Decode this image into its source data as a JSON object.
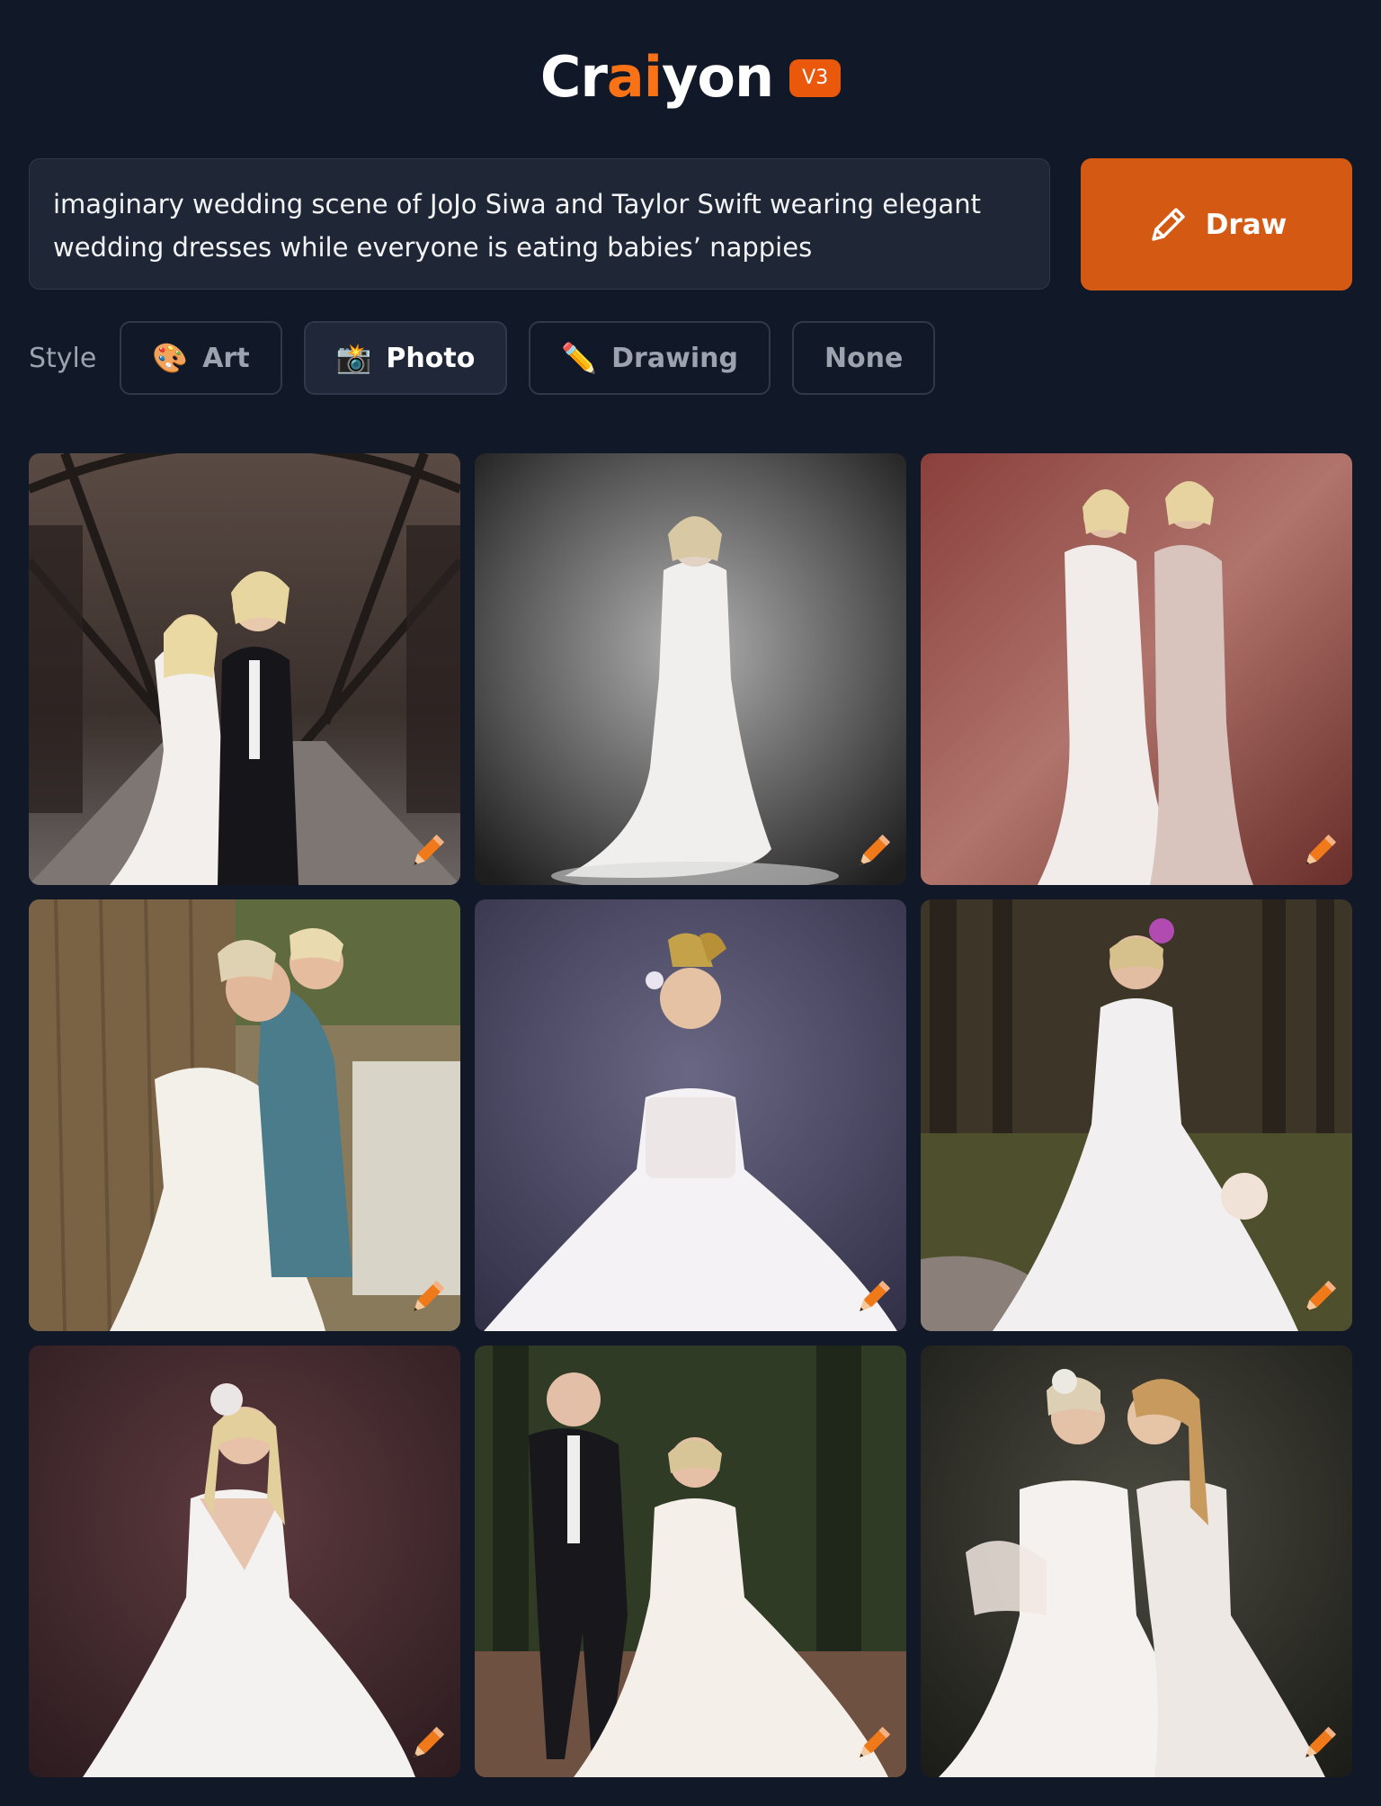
{
  "header": {
    "logo_parts": [
      "Cr",
      "ai",
      "yon"
    ],
    "version_badge": "V3",
    "accent_color": "#f97316"
  },
  "prompt": {
    "value": "imaginary wedding scene of JoJo Siwa and Taylor Swift wearing elegant\nwedding dresses while everyone is eating babies’ nappies"
  },
  "draw_button": {
    "label": "Draw",
    "icon": "pencil-icon",
    "color": "#d45a13"
  },
  "style": {
    "label": "Style",
    "options": [
      {
        "label": "Art",
        "icon": "palette-emoji",
        "glyph": "🎨",
        "selected": false
      },
      {
        "label": "Photo",
        "icon": "camera-flash-emoji",
        "glyph": "📸",
        "selected": true
      },
      {
        "label": "Drawing",
        "icon": "pencil-emoji",
        "glyph": "✏️",
        "selected": false
      },
      {
        "label": "None",
        "icon": "",
        "glyph": "",
        "selected": false
      }
    ]
  },
  "images": [
    {
      "scene": "cathedral-corridor-couple",
      "icon": "edit-pencil-icon"
    },
    {
      "scene": "gray-studio-single-bride",
      "icon": "edit-pencil-icon"
    },
    {
      "scene": "rose-background-two-brides",
      "icon": "edit-pencil-icon"
    },
    {
      "scene": "tree-embrace-couple",
      "icon": "edit-pencil-icon"
    },
    {
      "scene": "purple-studio-bride-bow",
      "icon": "edit-pencil-icon"
    },
    {
      "scene": "forest-bride-bouquet",
      "icon": "edit-pencil-icon"
    },
    {
      "scene": "maroon-studio-blonde-bride",
      "icon": "edit-pencil-icon"
    },
    {
      "scene": "forest-path-groom-bride",
      "icon": "edit-pencil-icon"
    },
    {
      "scene": "dark-background-kissing-brides",
      "icon": "edit-pencil-icon"
    }
  ]
}
